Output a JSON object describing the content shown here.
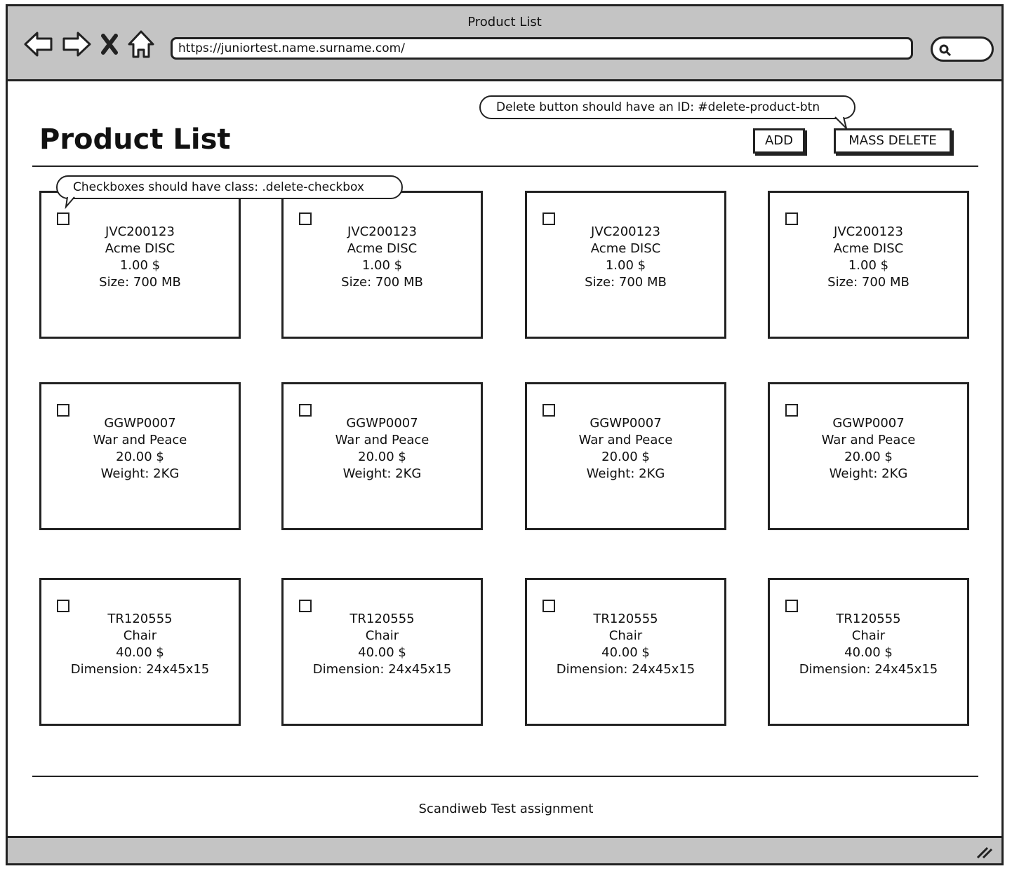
{
  "window": {
    "title": "Product List",
    "url": "https://juniortest.name.surname.com/"
  },
  "nav_icons": [
    "back-arrow-icon",
    "forward-arrow-icon",
    "close-x-icon",
    "home-icon",
    "search-icon",
    "resize-grip-icon"
  ],
  "header": {
    "title": "Product List",
    "add_label": "ADD",
    "mass_delete_label": "MASS DELETE",
    "delete_note": "Delete button should have an ID: #delete-product-btn",
    "checkbox_note": "Checkboxes should have class: .delete-checkbox"
  },
  "products": [
    {
      "sku": "JVC200123",
      "name": "Acme DISC",
      "price": "1.00 $",
      "attr": "Size: 700 MB"
    },
    {
      "sku": "JVC200123",
      "name": "Acme DISC",
      "price": "1.00 $",
      "attr": "Size: 700 MB"
    },
    {
      "sku": "JVC200123",
      "name": "Acme DISC",
      "price": "1.00 $",
      "attr": "Size: 700 MB"
    },
    {
      "sku": "JVC200123",
      "name": "Acme DISC",
      "price": "1.00 $",
      "attr": "Size: 700 MB"
    },
    {
      "sku": "GGWP0007",
      "name": "War and Peace",
      "price": "20.00 $",
      "attr": "Weight: 2KG"
    },
    {
      "sku": "GGWP0007",
      "name": "War and Peace",
      "price": "20.00 $",
      "attr": "Weight: 2KG"
    },
    {
      "sku": "GGWP0007",
      "name": "War and Peace",
      "price": "20.00 $",
      "attr": "Weight: 2KG"
    },
    {
      "sku": "GGWP0007",
      "name": "War and Peace",
      "price": "20.00 $",
      "attr": "Weight: 2KG"
    },
    {
      "sku": "TR120555",
      "name": "Chair",
      "price": "40.00 $",
      "attr": "Dimension: 24x45x15"
    },
    {
      "sku": "TR120555",
      "name": "Chair",
      "price": "40.00 $",
      "attr": "Dimension: 24x45x15"
    },
    {
      "sku": "TR120555",
      "name": "Chair",
      "price": "40.00 $",
      "attr": "Dimension: 24x45x15"
    },
    {
      "sku": "TR120555",
      "name": "Chair",
      "price": "40.00 $",
      "attr": "Dimension: 24x45x15"
    }
  ],
  "footer": {
    "text": "Scandiweb Test assignment"
  }
}
